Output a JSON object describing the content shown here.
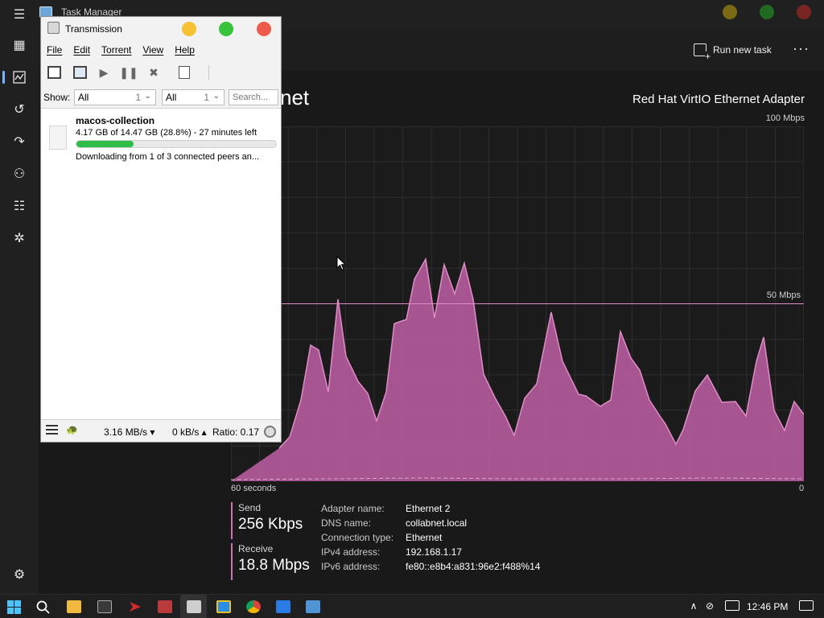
{
  "task_manager": {
    "title": "Task Manager",
    "toolbar": {
      "run_new_task": "Run new task",
      "more": "···"
    },
    "heading_partial": "net",
    "adapter_title": "Red Hat VirtIO Ethernet Adapter",
    "graph": {
      "max_label": "100 Mbps",
      "mid_label": "50 Mbps",
      "x_left": "60 seconds",
      "x_right": "0"
    },
    "send": {
      "label": "Send",
      "value": "256 Kbps"
    },
    "receive": {
      "label": "Receive",
      "value": "18.8 Mbps"
    },
    "properties": [
      {
        "key": "Adapter name:",
        "value": "Ethernet 2"
      },
      {
        "key": "DNS name:",
        "value": "collabnet.local"
      },
      {
        "key": "Connection type:",
        "value": "Ethernet"
      },
      {
        "key": "IPv4 address:",
        "value": "192.168.1.17"
      },
      {
        "key": "IPv6 address:",
        "value": "fe80::e8b4:a831:96e2:f488%14"
      }
    ],
    "colors": {
      "accent": "#d46fb5",
      "fill": "#b75c9f"
    }
  },
  "transmission": {
    "title": "Transmission",
    "menu": [
      "File",
      "Edit",
      "Torrent",
      "View",
      "Help"
    ],
    "filter": {
      "show_label": "Show:",
      "dropdown1": {
        "value": "All",
        "count": "1"
      },
      "dropdown2": {
        "value": "All",
        "count": "1"
      },
      "search_placeholder": "Search..."
    },
    "torrent": {
      "name": "macos-collection",
      "progress_text": "4.17 GB of 14.47 GB (28.8%) - 27 minutes left",
      "progress_fraction": 0.288,
      "status": "Downloading from 1 of 3 connected peers an..."
    },
    "statusbar": {
      "down": "3.16 MB/s ▾",
      "up": "0 kB/s ▴",
      "ratio": "Ratio: 0.17"
    }
  },
  "taskbar": {
    "clock": "12:46 PM"
  }
}
